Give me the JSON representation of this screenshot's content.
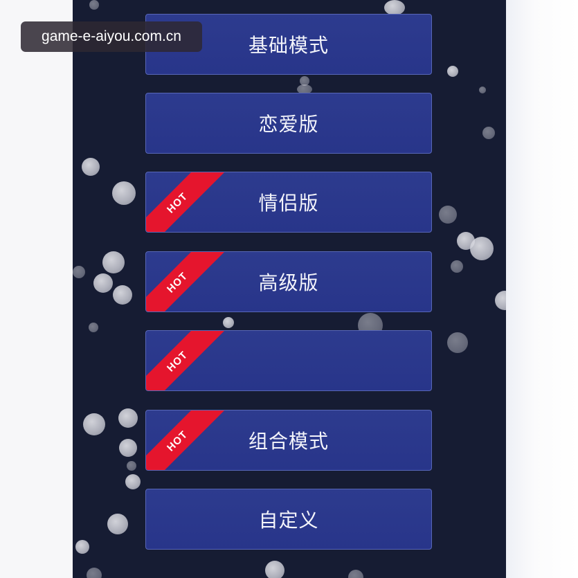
{
  "watermark": {
    "text": "game-e-aiyou.com.cn"
  },
  "modes": [
    {
      "label": "基础模式",
      "hot": false,
      "faded": false
    },
    {
      "label": "恋爱版",
      "hot": false,
      "faded": false
    },
    {
      "label": "情侣版",
      "hot": true,
      "faded": false
    },
    {
      "label": "高级版",
      "hot": true,
      "faded": false
    },
    {
      "label": "",
      "hot": true,
      "faded": true
    },
    {
      "label": "组合模式",
      "hot": true,
      "faded": false
    },
    {
      "label": "自定义",
      "hot": false,
      "faded": false
    }
  ],
  "hot_badge": "HOT",
  "colors": {
    "background": "#161c33",
    "button": "#2b388c",
    "button_border": "#5867b8",
    "hot_ribbon": "#e5152d"
  }
}
